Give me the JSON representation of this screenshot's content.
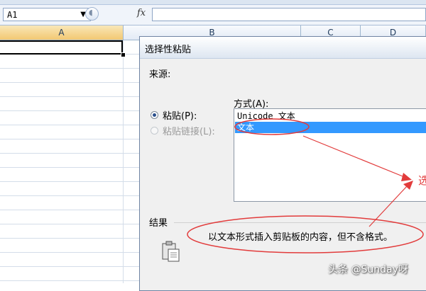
{
  "formula_bar": {
    "name_box": "A1",
    "name_box_arrow": "▼",
    "cancel_icon": "◖",
    "fx": "fx"
  },
  "columns": [
    "A",
    "B",
    "C",
    "D"
  ],
  "dialog": {
    "title": "选择性粘贴",
    "source_label": "来源:",
    "method_label": "方式(A):",
    "options": {
      "paste": "粘贴(P):",
      "paste_link": "粘贴链接(L):"
    },
    "selected_option": "paste",
    "method_list": [
      "Unicode 文本",
      "文本"
    ],
    "selected_method": "文本",
    "result_label": "结果",
    "result_text": "以文本形式插入剪贴板的内容，但不含格式。",
    "result_icon": "clipboard-icon"
  },
  "annotation": {
    "color": "#e23b3b",
    "text": "选"
  },
  "watermark": "头条 @Sunday呀"
}
